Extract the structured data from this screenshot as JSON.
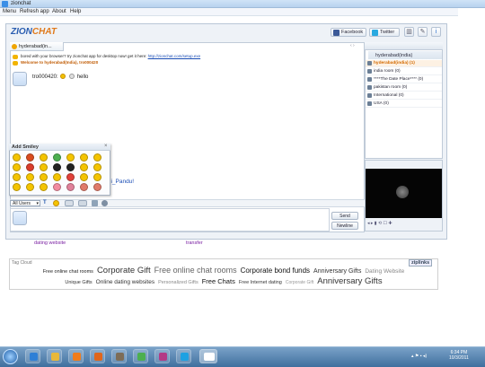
{
  "window": {
    "title": "zionchat"
  },
  "menu": {
    "items": [
      "Menu",
      "Refresh app",
      "About",
      "Help"
    ]
  },
  "header": {
    "logo_main": "ZION",
    "logo_accent": "CHAT",
    "facebook_label": "Facebook",
    "twitter_label": "Twitter"
  },
  "chat": {
    "tab_label": "hyderabad(in...",
    "tab_nav": "‹ ›",
    "system_message": "bored with your browser? try zionchat app for desktop now! get it here:",
    "system_link": "http://zionchat.com/setup.exe",
    "welcome": "Welcome to hyderabad(India), tro000420",
    "user_message_name": "tro000420:",
    "user_message_text": "hello",
    "partial_name": "ii_Pandu!"
  },
  "smiley_popup": {
    "title": "Add Smiley",
    "close": "×",
    "colors": [
      "#f4c400",
      "#d94c1f",
      "#f4c400",
      "#4caf50",
      "#f4c400",
      "#f4c400",
      "#f4c400",
      "#f4c400",
      "#d93d2b",
      "#f4c400",
      "#222222",
      "#222222",
      "#f4c400",
      "#f4c400",
      "#f4c400",
      "#f4c400",
      "#f4c400",
      "#f4c400",
      "#e0403a",
      "#f4c400",
      "#f4c400",
      "#f4c400",
      "#f4c400",
      "#f4c400",
      "#f28ba0",
      "#e0809a",
      "#e07a6a",
      "#e07a6a"
    ]
  },
  "toolbar": {
    "recipient": "All Users",
    "text_tool": "T"
  },
  "input": {
    "send_label": "Send",
    "newline_label": "Newline"
  },
  "rooms": {
    "title": "hyderabad(india)",
    "list": [
      {
        "name": "hyderabad(india) (1)",
        "active": true
      },
      {
        "name": "india room (0)",
        "active": false
      },
      {
        "name": "****The Date Place**** (0)",
        "active": false
      },
      {
        "name": "pakistan room (0)",
        "active": false
      },
      {
        "name": "International (0)",
        "active": false
      },
      {
        "name": "USA (0)",
        "active": false
      }
    ]
  },
  "page": {
    "link_dating": "dating website",
    "link_transfer": "transfer"
  },
  "tagcloud": {
    "title": "Tag Cloud",
    "logo": "ziplinks",
    "row1": [
      {
        "text": "Free online chat rooms",
        "size": "5.5px",
        "color": "#222",
        "weight": "normal"
      },
      {
        "text": "Corporate Gift",
        "size": "9.5px",
        "color": "#333",
        "weight": "normal"
      },
      {
        "text": "Free online chat rooms",
        "size": "9px",
        "color": "#666",
        "weight": "normal"
      },
      {
        "text": "Corporate bond funds",
        "size": "8px",
        "color": "#111",
        "weight": "normal"
      },
      {
        "text": "Anniversary Gifts",
        "size": "7px",
        "color": "#333",
        "weight": "normal"
      },
      {
        "text": "Dating Website",
        "size": "6.5px",
        "color": "#888",
        "weight": "normal"
      }
    ],
    "row2": [
      {
        "text": "Unique Gifts",
        "size": "5.5px",
        "color": "#333",
        "weight": "normal"
      },
      {
        "text": "Online dating websites",
        "size": "6.5px",
        "color": "#333",
        "weight": "normal"
      },
      {
        "text": "Personalized Gifts",
        "size": "5.5px",
        "color": "#888",
        "weight": "normal"
      },
      {
        "text": "Free Chats",
        "size": "7.5px",
        "color": "#111",
        "weight": "normal"
      },
      {
        "text": "Free Internet dating",
        "size": "5.5px",
        "color": "#333",
        "weight": "normal"
      },
      {
        "text": "Corporate Gift",
        "size": "5px",
        "color": "#999",
        "weight": "normal"
      },
      {
        "text": "Anniversary Gifts",
        "size": "9.5px",
        "color": "#333",
        "weight": "normal"
      }
    ]
  },
  "taskbar": {
    "time": "6:34 PM",
    "date": "10/3/2011"
  }
}
